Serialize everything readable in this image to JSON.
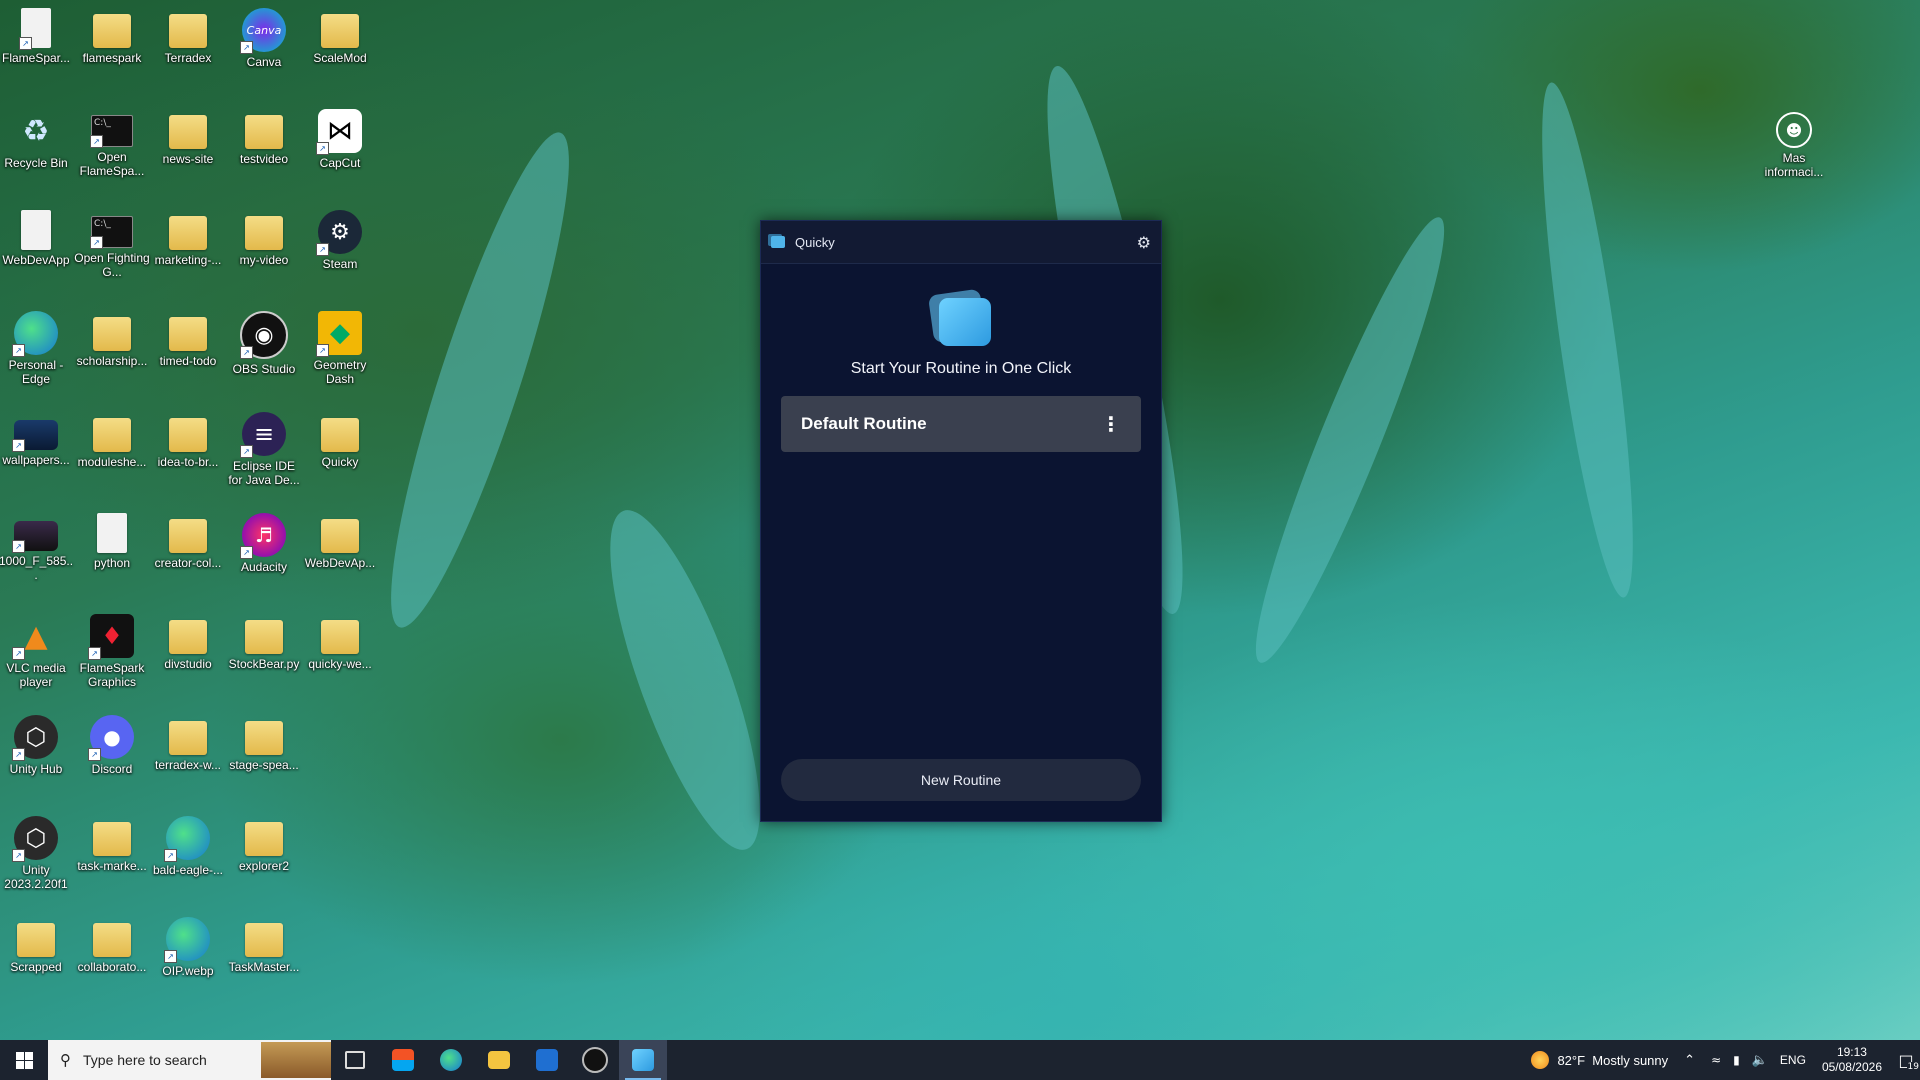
{
  "desktop": {
    "columns": [
      [
        {
          "label": "FlameSpar...",
          "icon": "file-icon",
          "kind": "file-dark"
        },
        {
          "label": "Recycle Bin",
          "icon": "recycle-bin-icon",
          "kind": "bin"
        },
        {
          "label": "WebDevApp",
          "icon": "file-icon",
          "kind": "file"
        },
        {
          "label": "Personal - Edge",
          "icon": "edge-icon",
          "kind": "edge"
        },
        {
          "label": "wallpapers...",
          "icon": "image-icon",
          "kind": "image"
        },
        {
          "label": "1000_F_585...",
          "icon": "image-icon",
          "kind": "image2"
        },
        {
          "label": "VLC media player",
          "icon": "vlc-icon",
          "kind": "vlc"
        },
        {
          "label": "Unity Hub",
          "icon": "unity-hub-icon",
          "kind": "unity"
        },
        {
          "label": "Unity 2023.2.20f1",
          "icon": "unity-icon",
          "kind": "unity"
        },
        {
          "label": "Scrapped",
          "icon": "folder-icon",
          "kind": "folder"
        }
      ],
      [
        {
          "label": "flamespark",
          "icon": "folder-icon",
          "kind": "folder"
        },
        {
          "label": "Open FlameSpa...",
          "icon": "terminal-icon",
          "kind": "cmd"
        },
        {
          "label": "Open Fighting G...",
          "icon": "terminal-icon",
          "kind": "cmd"
        },
        {
          "label": "scholarship...",
          "icon": "folder-icon",
          "kind": "folder"
        },
        {
          "label": "moduleshe...",
          "icon": "folder-icon",
          "kind": "folder"
        },
        {
          "label": "python",
          "icon": "file-icon",
          "kind": "file"
        },
        {
          "label": "FlameSpark Graphics",
          "icon": "flamespark-icon",
          "kind": "flame"
        },
        {
          "label": "Discord",
          "icon": "discord-icon",
          "kind": "discord"
        },
        {
          "label": "task-marke...",
          "icon": "folder-icon",
          "kind": "folder"
        },
        {
          "label": "collaborato...",
          "icon": "folder-icon",
          "kind": "folder"
        }
      ],
      [
        {
          "label": "Terradex",
          "icon": "folder-icon",
          "kind": "folder"
        },
        {
          "label": "news-site",
          "icon": "folder-icon",
          "kind": "folder"
        },
        {
          "label": "marketing-...",
          "icon": "folder-icon",
          "kind": "folder"
        },
        {
          "label": "timed-todo",
          "icon": "folder-icon",
          "kind": "folder"
        },
        {
          "label": "idea-to-br...",
          "icon": "folder-icon",
          "kind": "folder"
        },
        {
          "label": "creator-col...",
          "icon": "folder-icon",
          "kind": "folder"
        },
        {
          "label": "divstudio",
          "icon": "folder-icon",
          "kind": "folder"
        },
        {
          "label": "terradex-w...",
          "icon": "folder-icon",
          "kind": "folder"
        },
        {
          "label": "bald-eagle-...",
          "icon": "edge-icon",
          "kind": "edge"
        },
        {
          "label": "OIP.webp",
          "icon": "edge-icon",
          "kind": "edge"
        }
      ],
      [
        {
          "label": "Canva",
          "icon": "canva-icon",
          "kind": "canva"
        },
        {
          "label": "testvideo",
          "icon": "folder-icon",
          "kind": "folder"
        },
        {
          "label": "my-video",
          "icon": "folder-icon",
          "kind": "folder"
        },
        {
          "label": "OBS Studio",
          "icon": "obs-icon",
          "kind": "obs"
        },
        {
          "label": "Eclipse IDE for Java De...",
          "icon": "eclipse-icon",
          "kind": "eclipse"
        },
        {
          "label": "Audacity",
          "icon": "audacity-icon",
          "kind": "audacity"
        },
        {
          "label": "StockBear.py",
          "icon": "folder-icon",
          "kind": "folder"
        },
        {
          "label": "stage-spea...",
          "icon": "folder-icon",
          "kind": "folder"
        },
        {
          "label": "explorer2",
          "icon": "folder-icon",
          "kind": "folder"
        },
        {
          "label": "TaskMaster...",
          "icon": "folder-icon",
          "kind": "folder"
        }
      ],
      [
        {
          "label": "ScaleMod",
          "icon": "folder-icon",
          "kind": "folder"
        },
        {
          "label": "CapCut",
          "icon": "capcut-icon",
          "kind": "capcut"
        },
        {
          "label": "Steam",
          "icon": "steam-icon",
          "kind": "steam"
        },
        {
          "label": "Geometry Dash",
          "icon": "geometry-dash-icon",
          "kind": "gd"
        },
        {
          "label": "Quicky",
          "icon": "folder-icon",
          "kind": "folder"
        },
        {
          "label": "WebDevAp...",
          "icon": "folder-icon",
          "kind": "folder"
        },
        {
          "label": "quicky-we...",
          "icon": "folder-icon",
          "kind": "folder"
        }
      ]
    ],
    "right_icon": {
      "label": "Mas informaci...",
      "icon": "user-circle-icon"
    }
  },
  "app": {
    "title": "Quicky",
    "settings_icon": "gear-icon",
    "heading": "Start Your Routine in One Click",
    "routines": [
      {
        "name": "Default Routine"
      }
    ],
    "more_icon": "kebab-icon",
    "new_button": "New Routine"
  },
  "taskbar": {
    "search_placeholder": "Type here to search",
    "apps": [
      "task-view-icon",
      "store-icon",
      "edge-icon",
      "file-explorer-icon",
      "outlook-icon",
      "obs-icon",
      "quicky-icon"
    ],
    "weather": {
      "temp": "82°F",
      "text": "Mostly sunny"
    },
    "language": "ENG",
    "time": "19:13",
    "date": "05/08/2026",
    "notifications": "19"
  },
  "colors": {
    "app_bg": "#0b1431",
    "titlebar": "#121a33",
    "card": "#3a404f",
    "accent": "#4fb4ea",
    "taskbar": "#1c232f"
  }
}
